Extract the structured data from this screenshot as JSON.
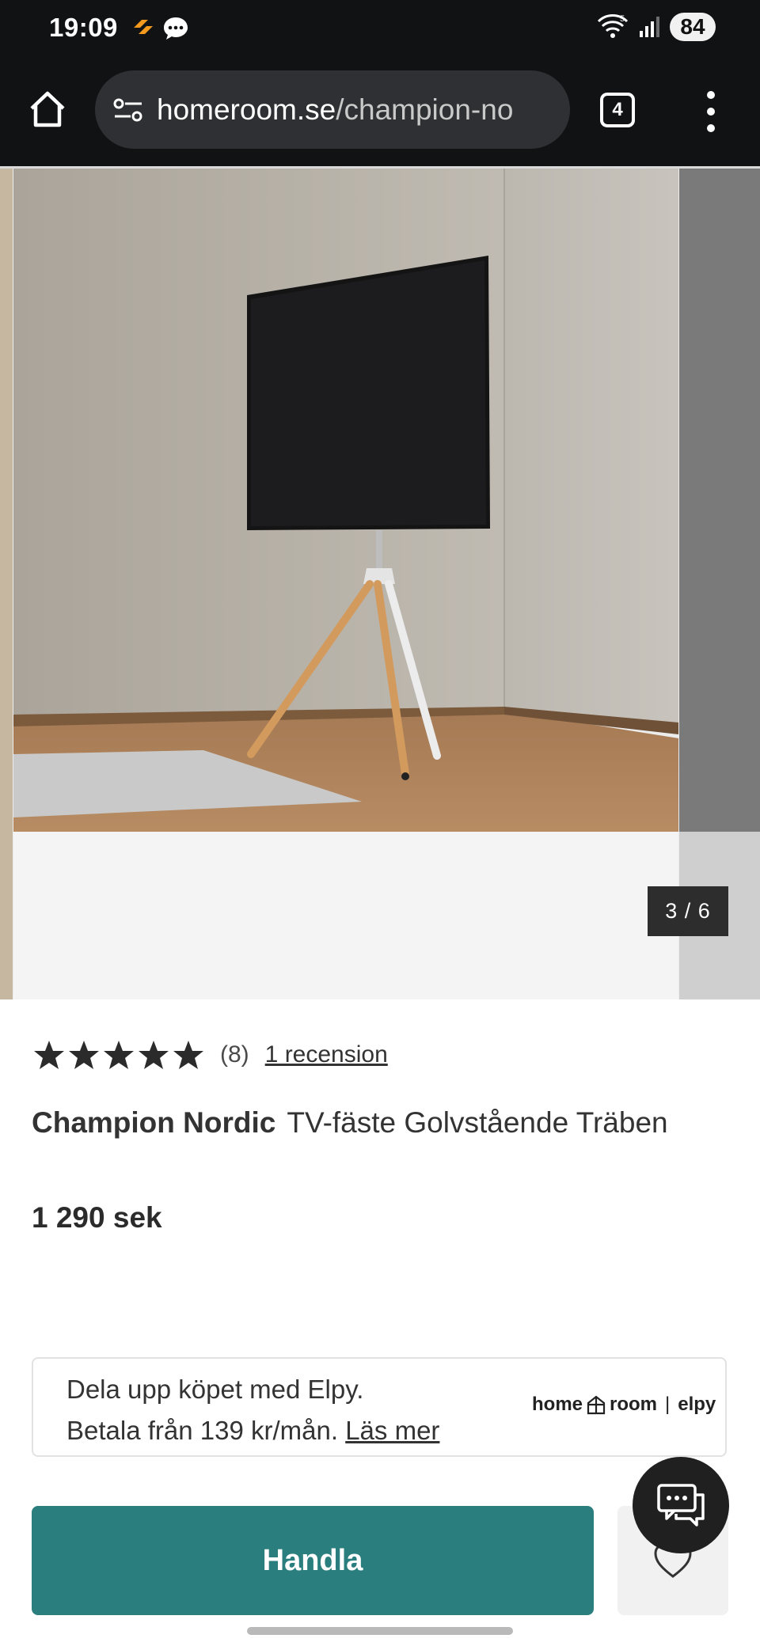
{
  "status_bar": {
    "time": "19:09",
    "notification_icons": [
      "app-notification-icon",
      "message-icon"
    ],
    "wifi_label": "5",
    "battery": "84"
  },
  "browser": {
    "url_host": "homeroom.se",
    "url_path": "/champion-no",
    "tab_count": "4"
  },
  "gallery": {
    "counter": "3 / 6"
  },
  "product": {
    "rating_stars": 5,
    "review_count": "(8)",
    "review_link": "1 recension",
    "brand": "Champion Nordic",
    "name": "TV-fäste Golvstående Träben",
    "price": "1 290 sek"
  },
  "elpy": {
    "line1": "Dela upp köpet med Elpy.",
    "line2_prefix": "Betala från 139 kr/mån.",
    "link": "Läs mer",
    "logo_home": "home",
    "logo_room": "room",
    "logo_elpy": "elpy"
  },
  "actions": {
    "buy_label": "Handla"
  },
  "colors": {
    "accent": "#2a7f7e",
    "chrome": "#111214"
  }
}
